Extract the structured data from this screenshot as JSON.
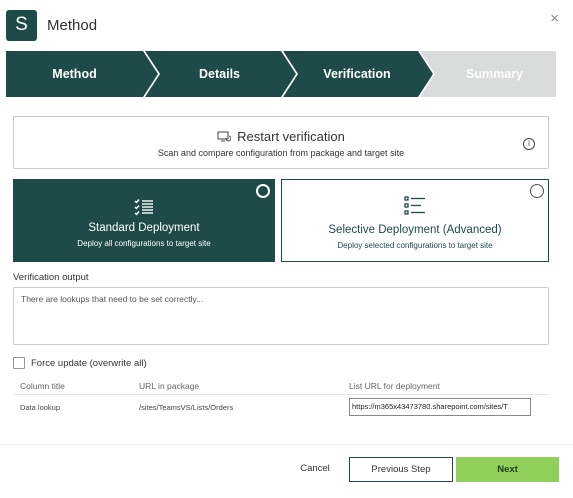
{
  "app": {
    "logo_letter": "S",
    "title": "Method",
    "close": "×"
  },
  "steps": [
    {
      "label": "Method",
      "state": "done"
    },
    {
      "label": "Details",
      "state": "done"
    },
    {
      "label": "Verification",
      "state": "active"
    },
    {
      "label": "Summary",
      "state": "pending"
    }
  ],
  "restart": {
    "title": "Restart verification",
    "subtitle": "Scan and compare configuration from package and target site",
    "info": "i"
  },
  "deployment": {
    "standard": {
      "title": "Standard Deployment",
      "subtitle": "Deploy all configurations to target site",
      "selected": true
    },
    "selective": {
      "title": "Selective Deployment (Advanced)",
      "subtitle": "Deploy selected configurations to target site",
      "selected": false
    }
  },
  "verification": {
    "label": "Verification output",
    "text": "There are lookups that need to be set correctly..."
  },
  "force_update": {
    "label": "Force update (overwrite all)",
    "checked": false
  },
  "table": {
    "headers": [
      "Column title",
      "URL in package",
      "List URL for deployment"
    ],
    "rows": [
      {
        "column_title": "Data lookup",
        "url_in_package": "/sites/TeamsVS/Lists/Orders",
        "list_url": "https://m365x43473780.sharepoint.com/sites/T"
      }
    ]
  },
  "footer": {
    "cancel": "Cancel",
    "previous": "Previous Step",
    "next": "Next"
  },
  "colors": {
    "primary": "#1e4a4a",
    "step_pending": "#d9dcdb",
    "accent_green": "#8fcf5a"
  }
}
